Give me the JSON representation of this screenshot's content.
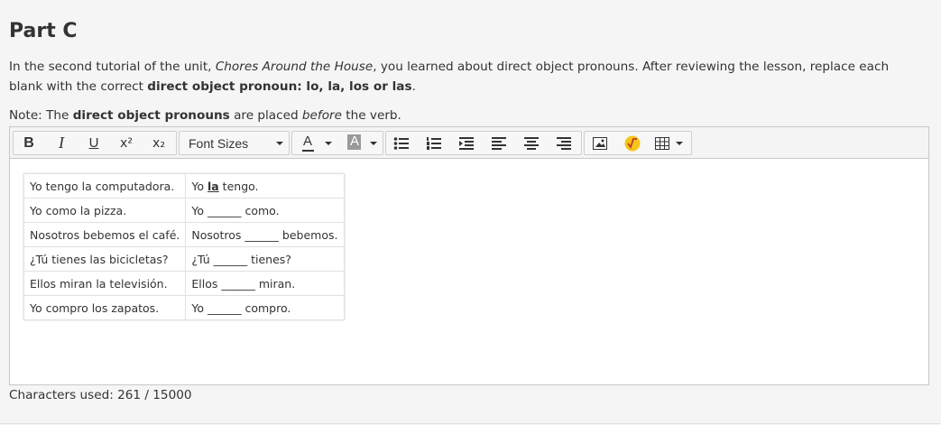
{
  "section": {
    "title": "Part C"
  },
  "intro": {
    "t1": "In the second tutorial of the unit, ",
    "t2": "Chores Around the House",
    "t3": ", you learned about direct object pronouns. After reviewing the lesson, replace each blank with the correct ",
    "t4": "direct object pronoun: lo, la, los or las",
    "t5": "."
  },
  "note": {
    "t1": "Note: The ",
    "t2": "direct object pronouns",
    "t3": " are placed ",
    "t4": "before",
    "t5": " the verb."
  },
  "toolbar": {
    "bold": "B",
    "italic": "I",
    "underline": "U",
    "superscript": "x²",
    "subscript": "x₂",
    "font_sizes": "Font Sizes",
    "text_color": "A",
    "bg_color": "A",
    "icons": [
      "bullet-list-icon",
      "numbered-list-icon",
      "indent-icon",
      "align-left-icon",
      "align-center-icon",
      "align-right-icon",
      "image-icon",
      "math-icon",
      "table-icon"
    ],
    "colors": {
      "math_bg": "#f5c518"
    }
  },
  "exercise": {
    "rows": [
      {
        "sentence": "Yo tengo la computadora.",
        "a": "Yo ",
        "answer": "la",
        "blank": "",
        "b": " tengo."
      },
      {
        "sentence": "Yo como la pizza.",
        "a": "Yo ",
        "answer": "",
        "blank": "______",
        "b": " como."
      },
      {
        "sentence": "Nosotros bebemos el café.",
        "a": "Nosotros ",
        "answer": "",
        "blank": "______",
        "b": " bebemos."
      },
      {
        "sentence": "¿Tú tienes las bicicletas?",
        "a": "¿Tú ",
        "answer": "",
        "blank": "______",
        "b": " tienes?"
      },
      {
        "sentence": "Ellos miran la televisión.",
        "a": "Ellos ",
        "answer": "",
        "blank": "______",
        "b": " miran."
      },
      {
        "sentence": "Yo compro los zapatos.",
        "a": "Yo ",
        "answer": "",
        "blank": "______",
        "b": " compro."
      }
    ]
  },
  "footer": {
    "chars_used": "Characters used: 261 / 15000"
  }
}
